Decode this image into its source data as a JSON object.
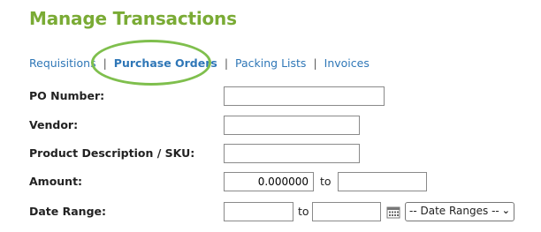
{
  "page": {
    "title": "Manage Transactions"
  },
  "nav": {
    "items": [
      {
        "label": "Requisitions",
        "active": false
      },
      {
        "label": "Purchase Orders",
        "active": true
      },
      {
        "label": "Packing Lists",
        "active": false
      },
      {
        "label": "Invoices",
        "active": false
      }
    ],
    "separator": "|"
  },
  "form": {
    "po_number": {
      "label": "PO Number:",
      "value": ""
    },
    "vendor": {
      "label": "Vendor:",
      "value": ""
    },
    "product": {
      "label": "Product Description / SKU:",
      "value": ""
    },
    "amount": {
      "label": "Amount:",
      "from_value": "0.000000",
      "to_label": "to",
      "to_value": ""
    },
    "date_range": {
      "label": "Date Range:",
      "from_value": "",
      "to_label": "to",
      "to_value": "",
      "calendar_icon": "calendar-icon",
      "select_value": "-- Date Ranges --"
    }
  },
  "colors": {
    "title": "#7aab35",
    "link": "#2f77b7",
    "highlight": "#7fbf4d"
  }
}
